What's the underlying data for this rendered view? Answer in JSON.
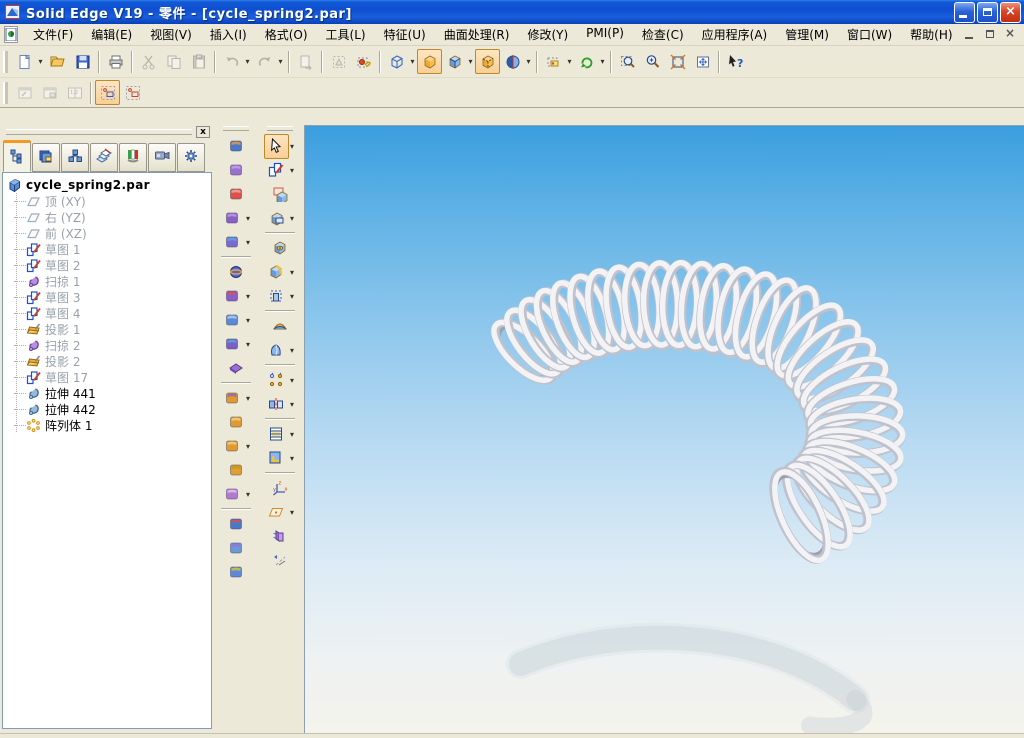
{
  "window": {
    "title": "Solid Edge V19 - 零件 - [cycle_spring2.par]",
    "controls": {
      "minimize": "minimize",
      "restore": "restore",
      "close": "close"
    }
  },
  "menu_bar": {
    "items": [
      {
        "label": "文件(F)"
      },
      {
        "label": "编辑(E)"
      },
      {
        "label": "视图(V)"
      },
      {
        "label": "插入(I)"
      },
      {
        "label": "格式(O)"
      },
      {
        "label": "工具(L)"
      },
      {
        "label": "特征(U)"
      },
      {
        "label": "曲面处理(R)"
      },
      {
        "label": "修改(Y)"
      },
      {
        "label": "PMI(P)"
      },
      {
        "label": "检查(C)"
      },
      {
        "label": "应用程序(A)"
      },
      {
        "label": "管理(M)"
      },
      {
        "label": "窗口(W)"
      },
      {
        "label": "帮助(H)"
      }
    ],
    "mdi_controls": [
      "minimize",
      "restore",
      "close"
    ]
  },
  "toolbar_main": {
    "buttons": [
      {
        "name": "new",
        "dd": true
      },
      {
        "name": "open"
      },
      {
        "name": "save"
      },
      {
        "name": "print",
        "sep": true
      },
      {
        "name": "cut",
        "dis": true,
        "sep": true
      },
      {
        "name": "copy",
        "dis": true
      },
      {
        "name": "paste",
        "dis": true
      },
      {
        "name": "undo",
        "dis": true,
        "dd": true,
        "sep": true
      },
      {
        "name": "redo",
        "dis": true,
        "dd": true
      },
      {
        "name": "update-links",
        "dis": true,
        "sep": true
      },
      {
        "name": "select-fence",
        "dis": true,
        "sep": true
      },
      {
        "name": "insert-part-copy"
      },
      {
        "name": "view-wireframe",
        "dd": true,
        "sep": true
      },
      {
        "name": "view-shaded",
        "act": true
      },
      {
        "name": "view-shaded-edges",
        "dd": true
      },
      {
        "name": "view-visible-hidden-edges",
        "act": true
      },
      {
        "name": "view-render",
        "dd": true
      },
      {
        "name": "common-views",
        "dd": true,
        "sep": true
      },
      {
        "name": "rotate-view",
        "dd": true
      },
      {
        "name": "zoom-area",
        "sep": true
      },
      {
        "name": "zoom"
      },
      {
        "name": "fit"
      },
      {
        "name": "pan"
      },
      {
        "name": "help-pointer",
        "sep": true
      }
    ]
  },
  "toolbar_secondary": {
    "buttons": [
      {
        "name": "previous-window",
        "dis": true
      },
      {
        "name": "window-layout",
        "dis": true
      },
      {
        "name": "two-view-window",
        "dis": true
      },
      {
        "name": "sketch-display",
        "act": true,
        "sep": true
      },
      {
        "name": "hide-sketch-display"
      }
    ]
  },
  "edgebar": {
    "tabs": [
      {
        "name": "pathfinder",
        "active": true
      },
      {
        "name": "feature-library",
        "active": false
      },
      {
        "name": "family-of-parts",
        "active": false
      },
      {
        "name": "layers",
        "active": false
      },
      {
        "name": "sensors",
        "active": false
      },
      {
        "name": "feature-playback",
        "active": false
      },
      {
        "name": "engineering-reference",
        "active": false
      }
    ]
  },
  "feature_tree": {
    "root": {
      "icon": "part",
      "label": "cycle_spring2.par"
    },
    "items": [
      {
        "icon": "ref-plane",
        "label": "顶 (XY)",
        "state": "dim"
      },
      {
        "icon": "ref-plane",
        "label": "右 (YZ)",
        "state": "dim"
      },
      {
        "icon": "ref-plane",
        "label": "前 (XZ)",
        "state": "dim"
      },
      {
        "icon": "sketch",
        "label": "草图 1",
        "state": "dim"
      },
      {
        "icon": "sketch",
        "label": "草图 2",
        "state": "dim"
      },
      {
        "icon": "sweep",
        "label": "扫掠 1",
        "state": "dim"
      },
      {
        "icon": "sketch",
        "label": "草图 3",
        "state": "dim"
      },
      {
        "icon": "sketch",
        "label": "草图 4",
        "state": "dim"
      },
      {
        "icon": "projection",
        "label": "投影 1",
        "state": "dim"
      },
      {
        "icon": "sweep",
        "label": "扫掠 2",
        "state": "dim"
      },
      {
        "icon": "projection",
        "label": "投影 2",
        "state": "dim"
      },
      {
        "icon": "sketch",
        "label": "草图 17",
        "state": "dim"
      },
      {
        "icon": "extrude",
        "label": "拉伸 441",
        "state": "normal"
      },
      {
        "icon": "extrude",
        "label": "拉伸 442",
        "state": "normal"
      },
      {
        "icon": "pattern",
        "label": "阵列体 1",
        "state": "normal"
      }
    ]
  },
  "toolbar_surfacing": {
    "buttons": [
      {
        "name": "extruded-surface",
        "c": "#4a78c8",
        "c2": "#f0a030"
      },
      {
        "name": "swept-surface",
        "c": "#9a6fd0",
        "c2": "#c9a8ee"
      },
      {
        "name": "bluedot",
        "c": "#e05048",
        "c2": "#f4b0a8"
      },
      {
        "name": "bounded-surface",
        "c": "#8a5fc8",
        "c2": "#c0a0e8",
        "dd": true
      },
      {
        "name": "offset-surface",
        "c": "#7a6ad0",
        "c2": "#58b0e8",
        "dd": true
      },
      {
        "name": "revolved-surface",
        "c": "#3a58d0",
        "c2": "#f0a030",
        "sep": true
      },
      {
        "name": "trim-surface",
        "c": "#8a5fc8",
        "c2": "#e05048",
        "dd": true
      },
      {
        "name": "round-surface",
        "c": "#5a8ad8",
        "c2": "#b8d4f4",
        "dd": true
      },
      {
        "name": "copy-surface",
        "c": "#7a5fc8",
        "c2": "#58a8e0",
        "dd": true
      },
      {
        "name": "thicken",
        "c": "#6a4fb8",
        "c2": "#9a80d8"
      },
      {
        "name": "intersection-curve",
        "c": "#e09a30",
        "c2": "#8a60c8",
        "dd": true,
        "sep": true
      },
      {
        "name": "keypoint-curve",
        "c": "#e09a30",
        "c2": "#f8d088"
      },
      {
        "name": "curve-by-table",
        "c": "#e09a30",
        "c2": "#f8d088",
        "dd": true
      },
      {
        "name": "cross-curve",
        "c": "#e0a030",
        "c2": "#c89020"
      },
      {
        "name": "split-curve",
        "c": "#b07ad0",
        "c2": "#e8c8f4",
        "dd": true
      },
      {
        "name": "insert-part-copy2",
        "c": "#4a78c8",
        "c2": "#e05048",
        "sep": true
      },
      {
        "name": "construction-model",
        "c": "#6a9ad8",
        "c2": "#9a6fd0"
      },
      {
        "name": "inter-part-link",
        "c": "#5a8ad8",
        "c2": "#e8c820"
      }
    ]
  },
  "toolbar_features": {
    "buttons": [
      {
        "name": "select-tool",
        "act": true,
        "dd": true,
        "c": "#f8f8f8",
        "c2": "#404040"
      },
      {
        "name": "sketch",
        "dd": true,
        "c": "#2050c0",
        "c2": "#e03020"
      },
      {
        "name": "protrusion",
        "c": "#4a80cc",
        "c2": "#e05048"
      },
      {
        "name": "cutout",
        "c": "#4a80cc",
        "c2": "#a8c8ec",
        "dd": true
      },
      {
        "name": "hole",
        "c": "#4a80cc",
        "c2": "#f0c040",
        "sep": true
      },
      {
        "name": "round",
        "c": "#4a80cc",
        "c2": "#e8b838",
        "dd": true
      },
      {
        "name": "thin-wall",
        "c": "#5a8ad8",
        "c2": "#ffffff",
        "dd": true
      },
      {
        "name": "web-network",
        "c": "#e8a030",
        "c2": "#4a80cc",
        "sep": true
      },
      {
        "name": "lip",
        "c": "#58a0d8",
        "c2": "#b8d8f0",
        "dd": true
      },
      {
        "name": "pattern",
        "c": "#e8a020",
        "c2": "#4a80cc",
        "dd": true,
        "sep": true
      },
      {
        "name": "mirror-copy",
        "c": "#4a80cc",
        "c2": "#e03020",
        "dd": true
      },
      {
        "name": "part-family",
        "c": "#4a80cc",
        "c2": "#e8c838",
        "dd": true,
        "sep": true
      },
      {
        "name": "material-table",
        "c": "#4a80cc",
        "c2": "#f0c040",
        "dd": true
      },
      {
        "name": "coordinate-system",
        "c": "#3a60c0",
        "c2": "#e03020",
        "sep": true
      },
      {
        "name": "reference-plane",
        "c": "#e8a030",
        "c2": "#ffffff",
        "dd": true
      },
      {
        "name": "construction-display",
        "c": "#8a5fc8",
        "c2": "#4a80cc"
      },
      {
        "name": "sketch-axis",
        "c": "#4a80cc",
        "c2": "#9a9a9a"
      }
    ]
  },
  "viewport": {
    "background_top_color": "#3b9edf",
    "background_bottom_color": "#f4f3ec",
    "model": {
      "name": "cycle_spring2",
      "description": "C-shaped curved helical coil spring, shaded white, with faint ground shadow",
      "turns": 30,
      "material_color": "#eeeef2"
    }
  }
}
